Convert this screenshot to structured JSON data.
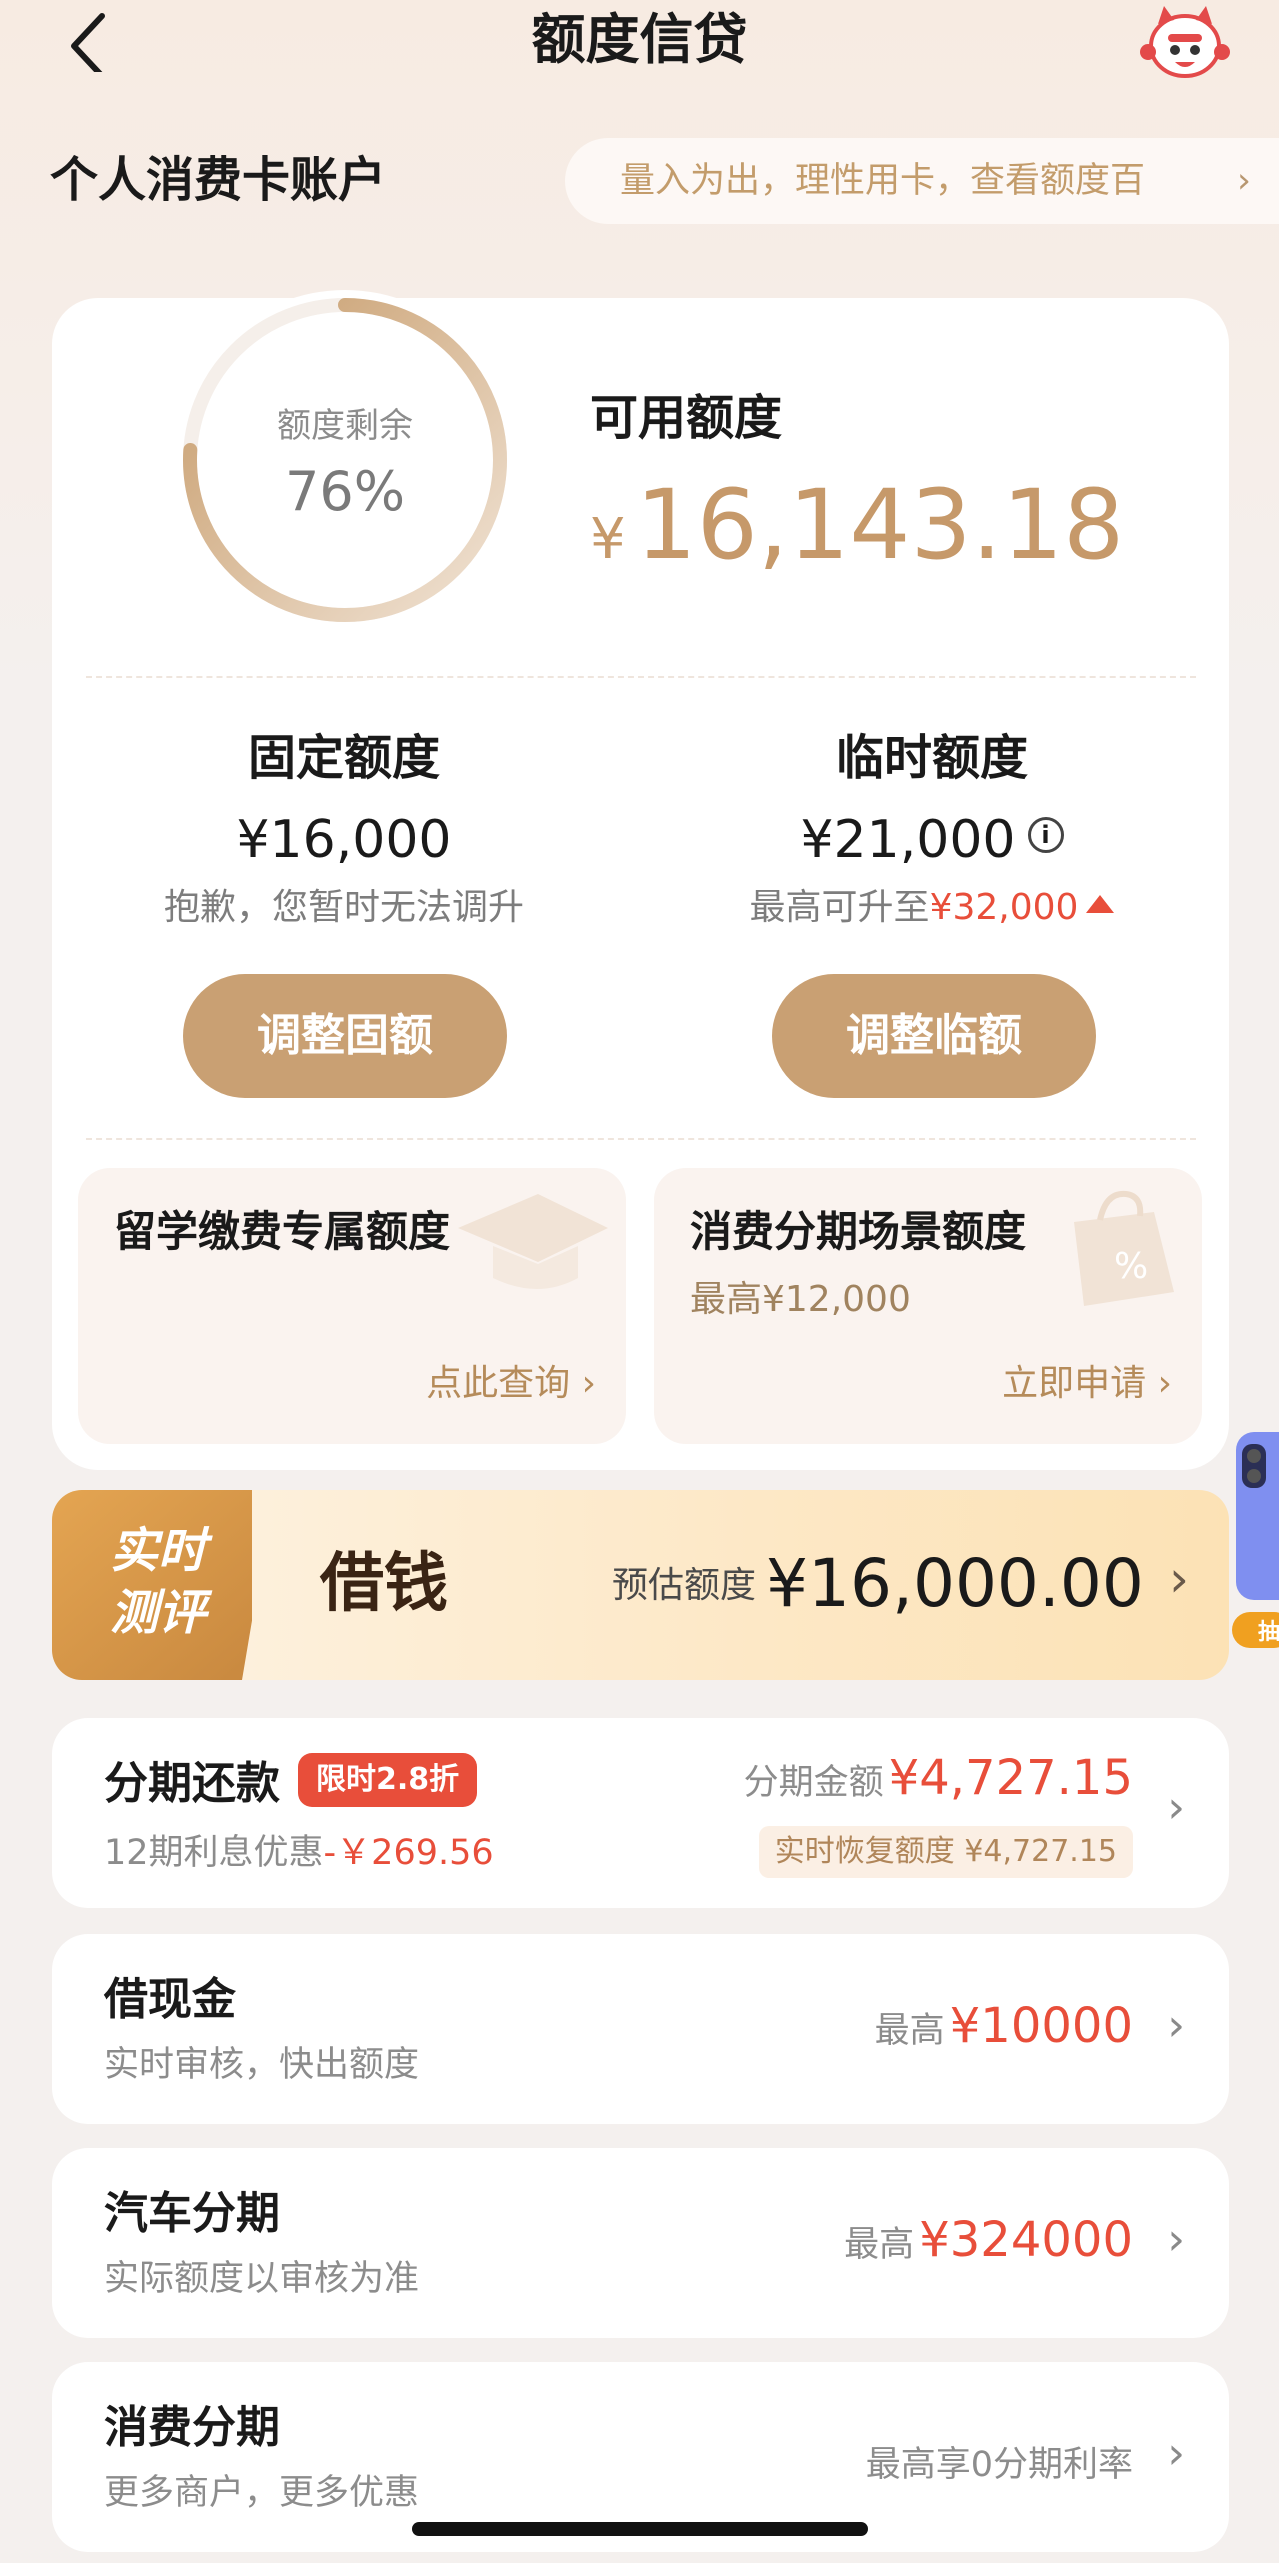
{
  "header": {
    "title": "额度信贷"
  },
  "account": {
    "title": "个人消费卡账户",
    "tip": "量入为出，理性用卡，查看额度百"
  },
  "credit": {
    "ring_label": "额度剩余",
    "ring_percent": "76%",
    "ring_fraction": 0.76,
    "available_label": "可用额度",
    "currency": "¥",
    "available_amount": "16,143.18"
  },
  "fixed": {
    "title": "固定额度",
    "amount": "¥16,000",
    "note": "抱歉，您暂时无法调升",
    "button": "调整固额"
  },
  "temp": {
    "title": "临时额度",
    "amount": "¥21,000",
    "info": "i",
    "note_prefix": "最高可升至",
    "note_amount": "¥32,000",
    "button": "调整临额"
  },
  "study": {
    "title": "留学缴费专属额度",
    "link": "点此查询 ›"
  },
  "installment_scene": {
    "title": "消费分期场景额度",
    "note": "最高¥12,000",
    "link": "立即申请 ›"
  },
  "loan": {
    "badge_line1": "实时",
    "badge_line2": "测评",
    "title": "借钱",
    "est_label": "预估额度",
    "amount": "¥16,000.00"
  },
  "side_tab": {
    "label": "抽"
  },
  "items": {
    "repay": {
      "title": "分期还款",
      "badge": "限时2.8折",
      "sub": "12期利息优惠",
      "discount": "-￥269.56",
      "amount_label": "分期金额",
      "amount": "¥4,727.15",
      "restore": "实时恢复额度 ¥4,727.15"
    },
    "cash": {
      "title": "借现金",
      "sub": "实时审核，快出额度",
      "label": "最高",
      "amount": "¥10000"
    },
    "car": {
      "title": "汽车分期",
      "sub": "实际额度以审核为准",
      "label": "最高",
      "amount": "¥324000"
    },
    "consume": {
      "title": "消费分期",
      "sub": "更多商户，更多优惠",
      "right": "最高享0分期利率"
    }
  },
  "colors": {
    "accent": "#c9a073",
    "gold_text": "#c6996a",
    "red": "#e84e3a"
  }
}
